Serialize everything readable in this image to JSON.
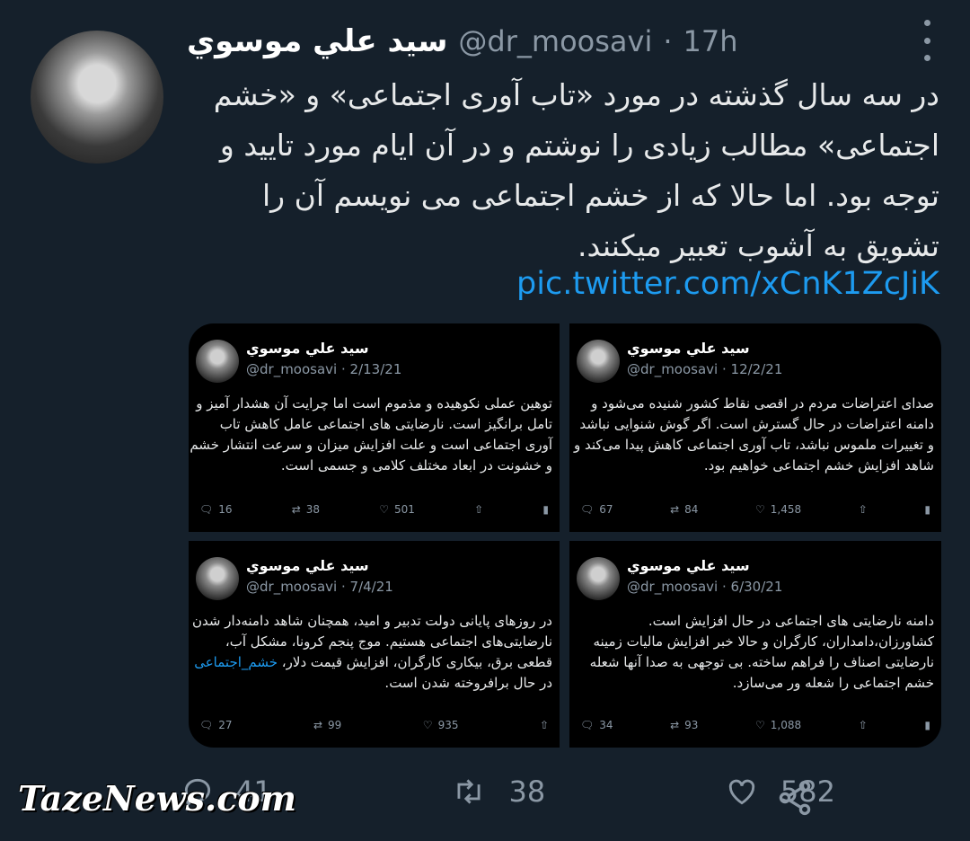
{
  "tweet": {
    "name": "سيد علي موسوي",
    "handle": "@dr_moosavi",
    "separator": "·",
    "time": "17h",
    "text": "در سه سال گذشته در مورد «تاب آوری اجتماعی» و «خشم اجتماعی» مطالب زیادی را نوشتم و در آن ایام مورد تایید و توجه بود. اما حالا که از خشم اجتماعی می نویسم آن را تشویق به آشوب تعبیر میکنند.",
    "link": "pic.twitter.com/xCnK1ZcJiK"
  },
  "embedded": [
    {
      "name": "سيد علي موسوي",
      "handle": "@dr_moosavi",
      "date": "· 2/13/21",
      "text": "توهین عملی نکوهیده و مذموم است اما چرایت آن هشدار آمیز و تامل برانگیز است. نارضایتی های اجتماعی عامل کاهش تاب آوری اجتماعی است و علت افزایش میزان و سرعت انتشار خشم و خشونت در ابعاد مختلف کلامی و جسمی است.",
      "replies": "16",
      "retweets": "38",
      "likes": "501"
    },
    {
      "name": "سيد علي موسوي",
      "handle": "@dr_moosavi",
      "date": "· 12/2/21",
      "text": "صدای اعتراضات مردم در اقصی نقاط کشور شنیده می‌شود و دامنه اعتراضات در حال گسترش است. اگر گوش شنوایی نباشد و تغییرات ملموس نباشد، تاب آوری اجتماعی کاهش پیدا می‌کند و شاهد افزایش خشم اجتماعی خواهیم بود.",
      "replies": "67",
      "retweets": "84",
      "likes": "1,458"
    },
    {
      "name": "سيد علي موسوي",
      "handle": "@dr_moosavi",
      "date": "· 7/4/21",
      "text_before": "در روزهای پایانی دولت تدبیر و امید، همچنان شاهد دامنه‌دار شدن نارضایتی‌های اجتماعی هستیم. موج پنجم کرونا، مشکل آب، قطعی برق، بیکاری کارگران، افزایش قیمت دلار، ",
      "highlight": "خشم_اجتماعی",
      "text_after": " در حال برافروخته شدن است.",
      "replies": "27",
      "retweets": "99",
      "likes": "935"
    },
    {
      "name": "سيد علي موسوي",
      "handle": "@dr_moosavi",
      "date": "· 6/30/21",
      "text": "دامنه نارضایتی های اجتماعی در حال افزایش است. کشاورزان،دامداران، کارگران و حالا خبر افزایش مالیات زمینه نارضایتی اصناف را فراهم ساخته. بی توجهی به صدا آنها شعله خشم اجتماعی را شعله ور می‌سازد.",
      "replies": "34",
      "retweets": "93",
      "likes": "1,088"
    }
  ],
  "actions": {
    "replies": "41",
    "retweets": "38",
    "likes": "582"
  },
  "watermark": "TazeNews.com",
  "colors": {
    "background": "#15202b",
    "link": "#1d9bf0",
    "muted": "#8b98a5"
  },
  "icons": [
    "more-icon",
    "reply-icon",
    "retweet-icon",
    "like-icon",
    "share-icon",
    "stats-icon"
  ]
}
